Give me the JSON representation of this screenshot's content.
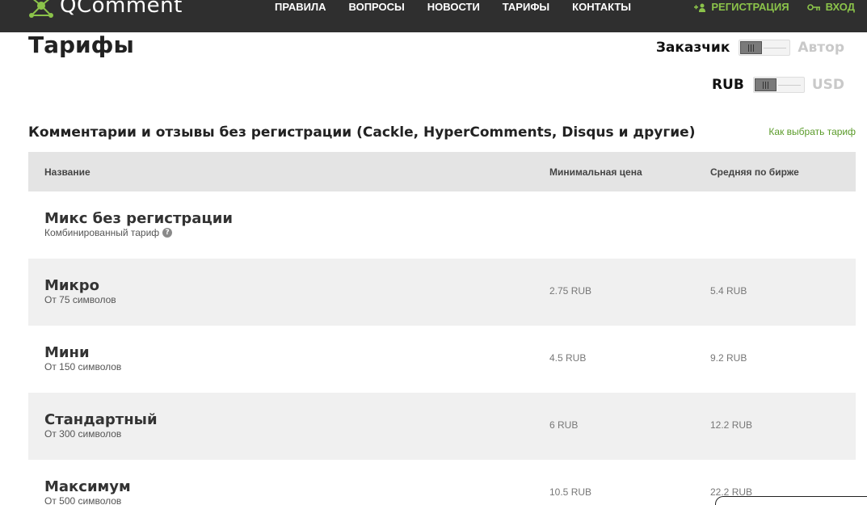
{
  "header": {
    "logo_text": "QComment",
    "nav": [
      "ПРАВИЛА",
      "ВОПРОСЫ",
      "НОВОСТИ",
      "ТАРИФЫ",
      "КОНТАКТЫ"
    ],
    "register_label": "РЕГИСТРАЦИЯ",
    "login_label": "ВХОД"
  },
  "page": {
    "title": "Тарифы"
  },
  "switches": {
    "role": {
      "left": "Заказчик",
      "right": "Автор",
      "selected": "Заказчик"
    },
    "currency": {
      "left": "RUB",
      "right": "USD",
      "selected": "RUB"
    }
  },
  "section": {
    "title": "Комментарии и отзывы без регистрации (Cackle, HyperComments, Disqus и другие)",
    "how_to_choose": "Как выбрать тариф"
  },
  "table": {
    "headers": {
      "name": "Название",
      "min_price": "Минимальная цена",
      "avg_price": "Средняя по бирже"
    },
    "rows": [
      {
        "name": "Микс без регистрации",
        "sub": "Комбинированный тариф",
        "min": "",
        "avg": ""
      },
      {
        "name": "Микро",
        "sub": "От 75 символов",
        "min": "2.75 RUB",
        "avg": "5.4 RUB"
      },
      {
        "name": "Мини",
        "sub": "От 150 символов",
        "min": "4.5 RUB",
        "avg": "9.2 RUB"
      },
      {
        "name": "Стандартный",
        "sub": "От 300 символов",
        "min": "6 RUB",
        "avg": "12.2 RUB"
      },
      {
        "name": "Максимум",
        "sub": "От 500 символов",
        "min": "10.5 RUB",
        "avg": "22.2 RUB"
      }
    ]
  },
  "colors": {
    "header_bg": "#2f2f2f",
    "accent_green": "#8bc34a",
    "link_green": "#5b9b2a",
    "table_header_bg": "#e4e4e4",
    "row_alt_bg": "#f0f0f0"
  }
}
